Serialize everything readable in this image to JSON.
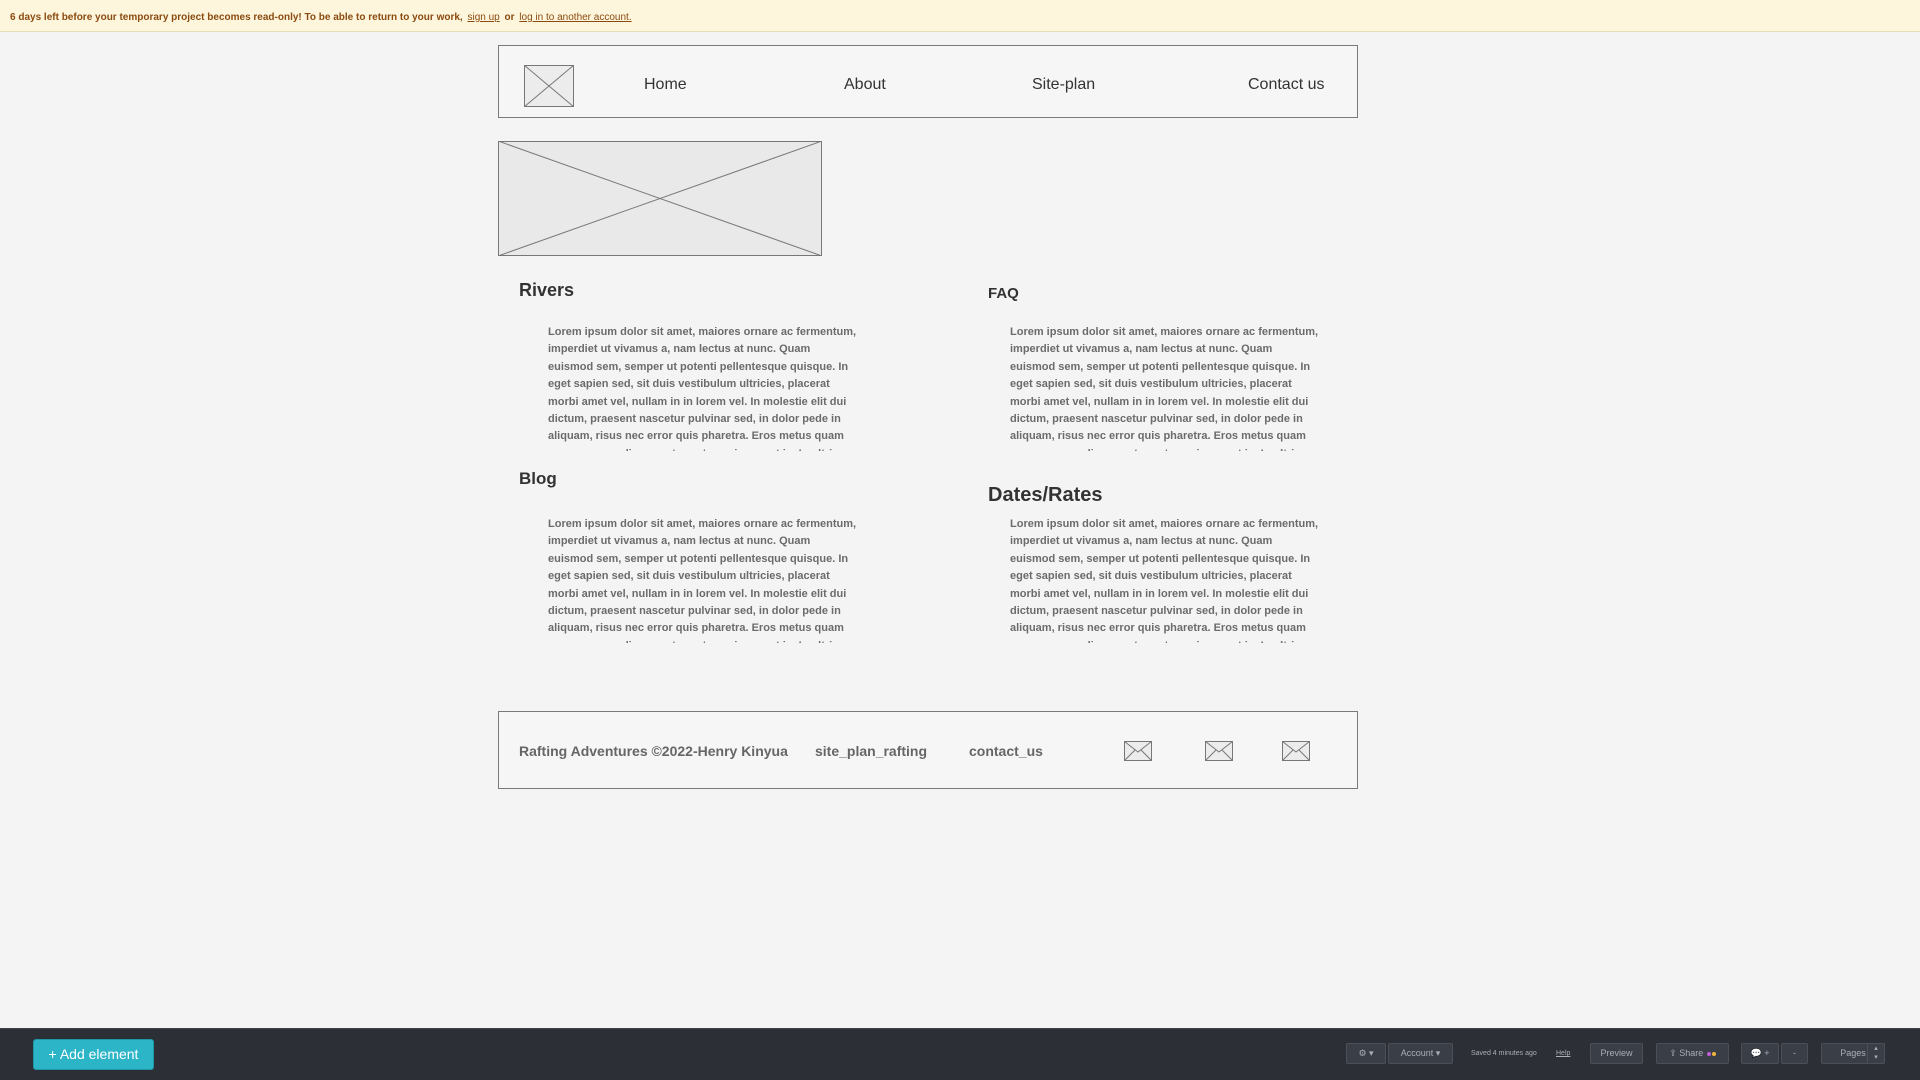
{
  "banner": {
    "message": "6 days left before your temporary project becomes read-only! To be able to return to your work,",
    "signup_link": "sign up",
    "or_text": "or",
    "login_link": "log in to another account."
  },
  "nav": {
    "logo_icon": "image-placeholder-icon",
    "items": [
      "Home",
      "About",
      "Site-plan",
      "Contact us"
    ]
  },
  "hero": {
    "icon": "image-placeholder-icon"
  },
  "sections": [
    {
      "title": "Rivers",
      "body": "Lorem ipsum dolor sit amet, maiores ornare ac fermentum, imperdiet ut vivamus a, nam lectus at nunc. Quam euismod sem, semper ut potenti pellentesque quisque. In eget sapien sed, sit duis vestibulum ultricies, placerat morbi amet vel, nullam in in lorem vel. In molestie elit dui dictum, praesent nascetur pulvinar sed, in dolor pede in aliquam, risus nec error quis pharetra. Eros metus quam augue suspendisse, metus rutrum risus erat in.  In ultrices quo ut lectus, etiam"
    },
    {
      "title": "FAQ",
      "body": "Lorem ipsum dolor sit amet, maiores ornare ac fermentum, imperdiet ut vivamus a, nam lectus at nunc. Quam euismod sem, semper ut potenti pellentesque quisque. In eget sapien sed, sit duis vestibulum ultricies, placerat morbi amet vel, nullam in in lorem vel. In molestie elit dui dictum, praesent nascetur pulvinar sed, in dolor pede in aliquam, risus nec error quis pharetra. Eros metus quam augue suspendisse, metus rutrum risus erat in.  In ultrices quo ut lectus, etiam"
    },
    {
      "title": "Blog",
      "body": "Lorem ipsum dolor sit amet, maiores ornare ac fermentum, imperdiet ut vivamus a, nam lectus at nunc. Quam euismod sem, semper ut potenti pellentesque quisque. In eget sapien sed, sit duis vestibulum ultricies, placerat morbi amet vel, nullam in in lorem vel. In molestie elit dui dictum, praesent nascetur pulvinar sed, in dolor pede in aliquam, risus nec error quis pharetra. Eros metus quam augue suspendisse, metus rutrum risus erat in.  In ultrices quo ut lectus, etiam"
    },
    {
      "title": "Dates/Rates",
      "body": "Lorem ipsum dolor sit amet, maiores ornare ac fermentum, imperdiet ut vivamus a, nam lectus at nunc. Quam euismod sem, semper ut potenti pellentesque quisque. In eget sapien sed, sit duis vestibulum ultricies, placerat morbi amet vel, nullam in in lorem vel. In molestie elit dui dictum, praesent nascetur pulvinar sed, in dolor pede in aliquam, risus nec error quis pharetra. Eros metus quam augue suspendisse, metus rutrum risus erat in.  In ultrices quo ut lectus, etiam"
    }
  ],
  "footer": {
    "copyright": "Rafting Adventures ©2022-Henry Kinyua",
    "links": [
      "site_plan_rafting",
      "contact_us"
    ],
    "icons": [
      "envelope-icon",
      "envelope-icon",
      "envelope-icon"
    ]
  },
  "toolbar": {
    "add_element": "+ Add element",
    "settings_icon": "gear-icon",
    "account": "Account",
    "saved_status": "Saved 4 minutes ago",
    "help": "Help",
    "preview": "Preview",
    "share": "Share",
    "comments_icon": "comment-icon",
    "comments_count": "+",
    "more": "-",
    "pages": "Pages",
    "colors": {
      "accent": "#2bb5c6",
      "share_dot_1": "#c05fd6",
      "share_dot_2": "#f0b43a"
    }
  }
}
